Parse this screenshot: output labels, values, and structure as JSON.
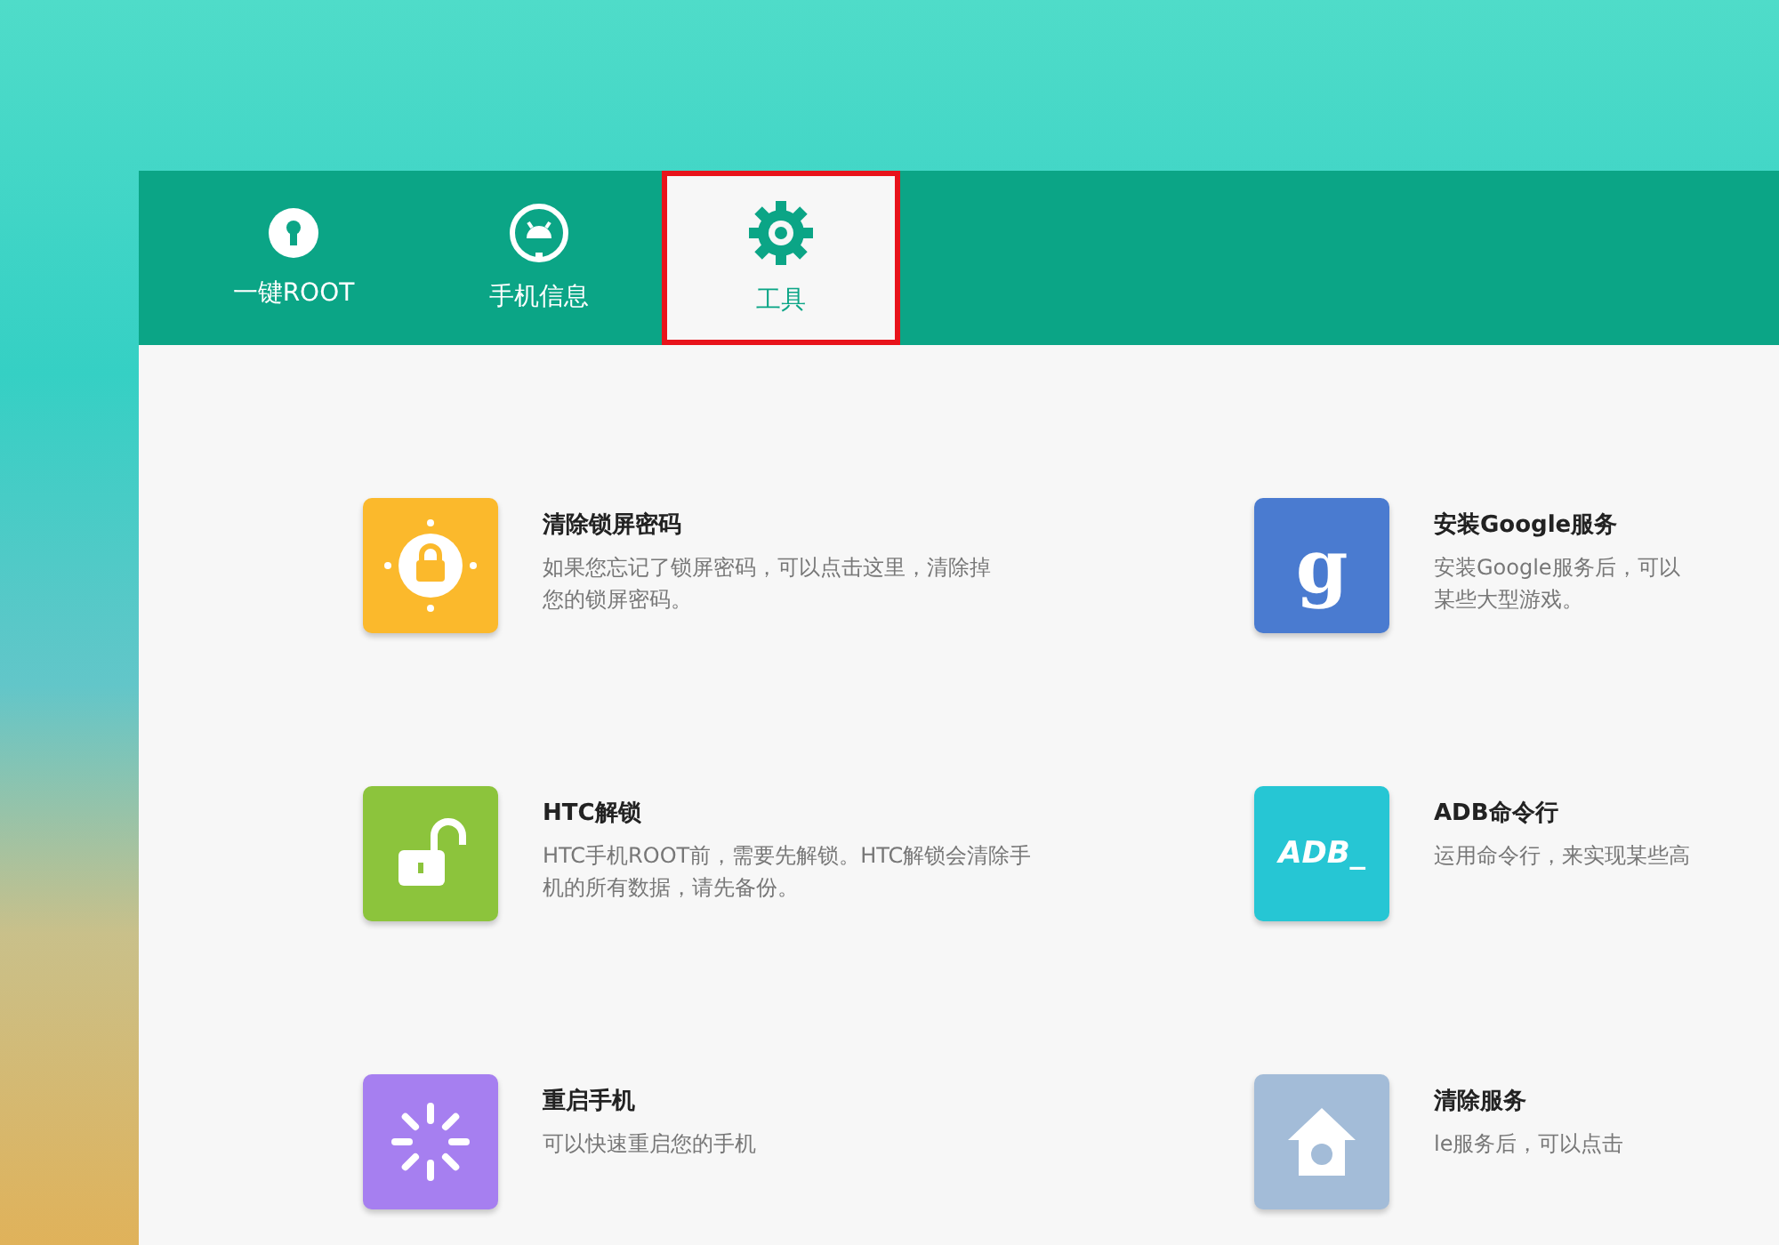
{
  "tabs": [
    {
      "label": "一键ROOT",
      "kind": "keyhole",
      "selected": false
    },
    {
      "label": "手机信息",
      "kind": "android",
      "selected": false
    },
    {
      "label": "工具",
      "kind": "gear",
      "selected": true
    }
  ],
  "tools": [
    {
      "kind": "lock",
      "color": "#fbb92c",
      "title": "清除锁屏密码",
      "description": [
        "如果您忘记了锁屏密码，可以点击这里，清除掉",
        "您的锁屏密码。"
      ]
    },
    {
      "kind": "letter",
      "color": "#4a7bd0",
      "icon_text": "g",
      "title": "安装Google服务",
      "description": [
        "安装Google服务后，可以",
        "某些大型游戏。"
      ]
    },
    {
      "kind": "unlock",
      "color": "#8cc43c",
      "title": "HTC解锁",
      "description": [
        "HTC手机ROOT前，需要先解锁。HTC解锁会清除手",
        "机的所有数据，请先备份。"
      ]
    },
    {
      "kind": "letter",
      "color": "#26c6d4",
      "icon_text": "ADB_",
      "title": "ADB命令行",
      "description": [
        "运用命令行，来实现某些高"
      ]
    },
    {
      "kind": "spinner",
      "color": "#a67ff0",
      "title": "重启手机",
      "description": [
        "可以快速重启您的手机"
      ]
    },
    {
      "kind": "house",
      "color": "#a3bcd8",
      "title": "清除服务",
      "description": [
        "le服务后，可以点击"
      ]
    }
  ]
}
